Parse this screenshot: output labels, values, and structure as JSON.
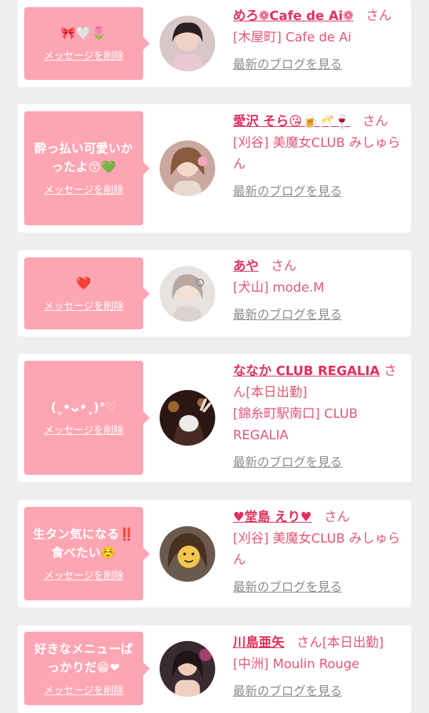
{
  "cards": [
    {
      "message": "🎀🤍🌷",
      "delete_label": "メッセージを削除",
      "name": "めろ❁Cafe de Ai❁",
      "suffix": "さん",
      "shop": "[木屋町] Cafe de Ai",
      "blog_label": "最新のブログを見る"
    },
    {
      "message": "酔っ払い可愛いかったよ😙💚",
      "delete_label": "メッセージを削除",
      "name": "愛沢 そら😘🍺🥂🍷",
      "suffix": "さん",
      "shop": "[刈谷] 美魔女CLUB みしゅらん",
      "blog_label": "最新のブログを見る"
    },
    {
      "message": "❤️",
      "delete_label": "メッセージを削除",
      "name": "あや",
      "suffix": "さん",
      "shop": "[犬山] mode.M",
      "blog_label": "最新のブログを見る"
    },
    {
      "message": "(ˬ•ᴗ•ˬ)°♡",
      "delete_label": "メッセージを削除",
      "name": "ななか CLUB REGALIA",
      "suffix": "さん[本日出勤]",
      "shop": "[錦糸町駅南口] CLUB REGALIA",
      "blog_label": "最新のブログを見る"
    },
    {
      "message": "生タン気になる‼️食べたい☺️",
      "delete_label": "メッセージを削除",
      "name": "♥堂島 えり♥",
      "suffix": "さん",
      "shop": "[刈谷] 美魔女CLUB みしゅらん",
      "blog_label": "最新のブログを見る"
    },
    {
      "message": "好きなメニューばっかりだ😁❤",
      "delete_label": "メッセージを削除",
      "name": "川島亜矢",
      "suffix": "さん[本日出勤]",
      "shop": "[中洲] Moulin Rouge",
      "blog_label": "最新のブログを見る"
    }
  ],
  "avatar_icon": "girl-photo-avatar",
  "colors": {
    "background": "#eeeeee",
    "card": "#ffffff",
    "bubble": "#fea5b3",
    "name": "#e0305c",
    "shop": "#e35677",
    "blog_link": "#8c8c8c"
  }
}
